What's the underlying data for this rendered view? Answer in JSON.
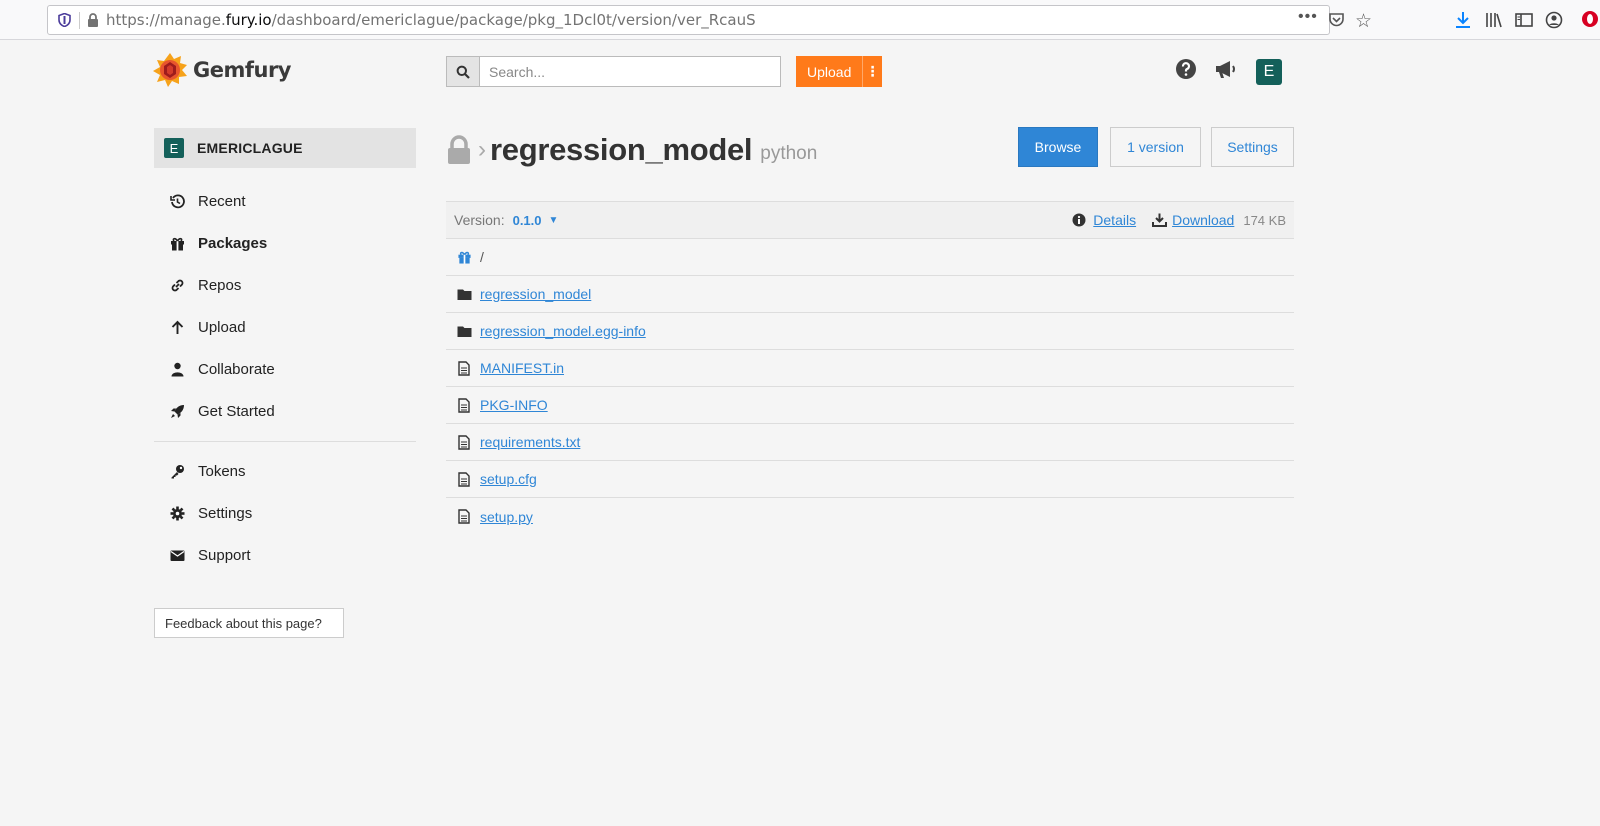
{
  "browser": {
    "url_prefix": "https://manage.",
    "url_domain": "fury.io",
    "url_suffix": "/dashboard/emericlague/package/pkg_1Dcl0t/version/ver_RcauS",
    "dots": "•••"
  },
  "header": {
    "logo_text": "Gemfury",
    "search_placeholder": "Search...",
    "upload_label": "Upload",
    "upload_more": "⋮",
    "avatar_initial": "E"
  },
  "sidebar": {
    "account_initial": "E",
    "account_name": "EMERICLAGUE",
    "items": [
      {
        "label": "Recent",
        "icon": "history-icon"
      },
      {
        "label": "Packages",
        "icon": "gift-icon"
      },
      {
        "label": "Repos",
        "icon": "link-icon"
      },
      {
        "label": "Upload",
        "icon": "arrow-up-icon"
      },
      {
        "label": "Collaborate",
        "icon": "user-icon"
      },
      {
        "label": "Get Started",
        "icon": "rocket-icon"
      }
    ],
    "items2": [
      {
        "label": "Tokens",
        "icon": "key-icon"
      },
      {
        "label": "Settings",
        "icon": "gear-icon"
      },
      {
        "label": "Support",
        "icon": "envelope-icon"
      }
    ],
    "active": "Packages",
    "feedback": "Feedback about this page?"
  },
  "main": {
    "chevron": "›",
    "package_name": "regression_model",
    "package_kind": "python",
    "buttons": {
      "browse": "Browse",
      "versions": "1 version",
      "settings": "Settings"
    },
    "version_label": "Version:",
    "version_value": "0.1.0",
    "caret": "▼",
    "details": "Details",
    "download": "Download",
    "size": "174 KB",
    "path": "/",
    "files": [
      {
        "name": "regression_model",
        "type": "folder"
      },
      {
        "name": "regression_model.egg-info",
        "type": "folder"
      },
      {
        "name": "MANIFEST.in",
        "type": "file"
      },
      {
        "name": "PKG-INFO",
        "type": "file"
      },
      {
        "name": "requirements.txt",
        "type": "file"
      },
      {
        "name": "setup.cfg",
        "type": "file"
      },
      {
        "name": "setup.py",
        "type": "file"
      }
    ]
  },
  "colors": {
    "accent": "#2f86d6",
    "upload": "#ff7a1a",
    "avatar": "#14605a"
  }
}
